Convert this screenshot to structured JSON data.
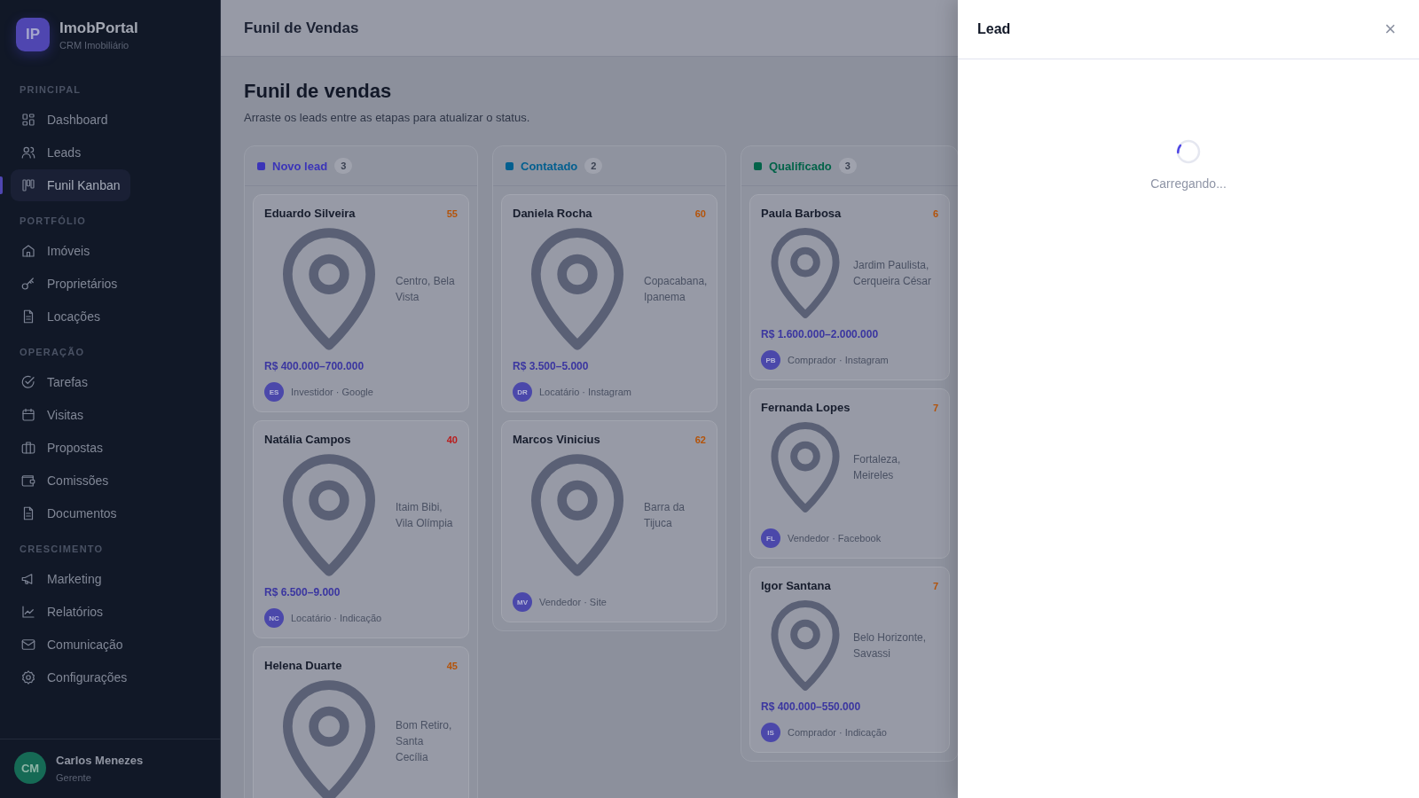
{
  "brand": {
    "logo": "IP",
    "name": "ImobPortal",
    "subtitle": "CRM Imobiliário"
  },
  "sidebar": {
    "sections": [
      {
        "title": "PRINCIPAL",
        "items": [
          {
            "label": "Dashboard",
            "selected": false
          },
          {
            "label": "Leads",
            "selected": false
          },
          {
            "label": "Funil Kanban",
            "selected": true
          }
        ]
      },
      {
        "title": "PORTFÓLIO",
        "items": [
          {
            "label": "Imóveis",
            "selected": false
          },
          {
            "label": "Proprietários",
            "selected": false
          },
          {
            "label": "Locações",
            "selected": false
          }
        ]
      },
      {
        "title": "OPERAÇÃO",
        "items": [
          {
            "label": "Tarefas",
            "selected": false
          },
          {
            "label": "Visitas",
            "selected": false
          },
          {
            "label": "Propostas",
            "selected": false
          },
          {
            "label": "Comissões",
            "selected": false
          },
          {
            "label": "Documentos",
            "selected": false
          }
        ]
      },
      {
        "title": "CRESCIMENTO",
        "items": [
          {
            "label": "Marketing",
            "selected": false
          },
          {
            "label": "Relatórios",
            "selected": false
          },
          {
            "label": "Comunicação",
            "selected": false
          },
          {
            "label": "Configurações",
            "selected": false
          }
        ]
      }
    ],
    "user": {
      "initials": "CM",
      "name": "Carlos Menezes",
      "role": "Gerente"
    }
  },
  "topbar": {
    "title": "Funil de Vendas"
  },
  "page": {
    "title": "Funil de vendas",
    "subtitle": "Arraste os leads entre as etapas para atualizar o status."
  },
  "columns": [
    {
      "title": "Novo lead",
      "count": "3",
      "color": "#3b34b8",
      "leads": [
        {
          "name": "Eduardo Silveira",
          "score": "55",
          "color": "#b45309",
          "location": "Centro, Bela Vista",
          "price": "R$ 400.000–700.000",
          "initials": "ES",
          "meta": "Investidor · Google"
        },
        {
          "name": "Natália Campos",
          "score": "40",
          "color": "#b91c1c",
          "location": "Itaim Bibi, Vila Olímpia",
          "price": "R$ 6.500–9.000",
          "initials": "NC",
          "meta": "Locatário · Indicação"
        },
        {
          "name": "Helena Duarte",
          "score": "45",
          "color": "#b45309",
          "location": "Bom Retiro, Santa Cecília"
        }
      ]
    },
    {
      "title": "Contatado",
      "count": "2",
      "color": "#035f8f",
      "leads": [
        {
          "name": "Daniela Rocha",
          "score": "60",
          "color": "#b45309",
          "location": "Copacabana, Ipanema",
          "price": "R$ 3.500–5.000",
          "initials": "DR",
          "meta": "Locatário · Instagram"
        },
        {
          "name": "Marcos Vinicius",
          "score": "62",
          "color": "#b45309",
          "location": "Barra da Tijuca",
          "initials": "MV",
          "meta": "Vendedor · Site"
        }
      ]
    },
    {
      "title": "Qualificado",
      "count": "3",
      "color": "#036349",
      "leads": [
        {
          "name": "Paula Barbosa",
          "score": "6",
          "color": "#b45309",
          "location": "Jardim Paulista, Cerqueira César",
          "price": "R$ 1.600.000–2.000.000",
          "initials": "PB",
          "meta": "Comprador · Instagram"
        },
        {
          "name": "Fernanda Lopes",
          "score": "7",
          "color": "#b45309",
          "location": "Fortaleza, Meireles",
          "initials": "FL",
          "meta": "Vendedor · Facebook"
        },
        {
          "name": "Igor Santana",
          "score": "7",
          "color": "#b45309",
          "location": "Belo Horizonte, Savassi",
          "price": "R$ 400.000–550.000",
          "initials": "IS",
          "meta": "Comprador · Indicação"
        }
      ]
    }
  ],
  "drawer": {
    "title": "Lead",
    "close": "×",
    "loading": "Carregando..."
  }
}
